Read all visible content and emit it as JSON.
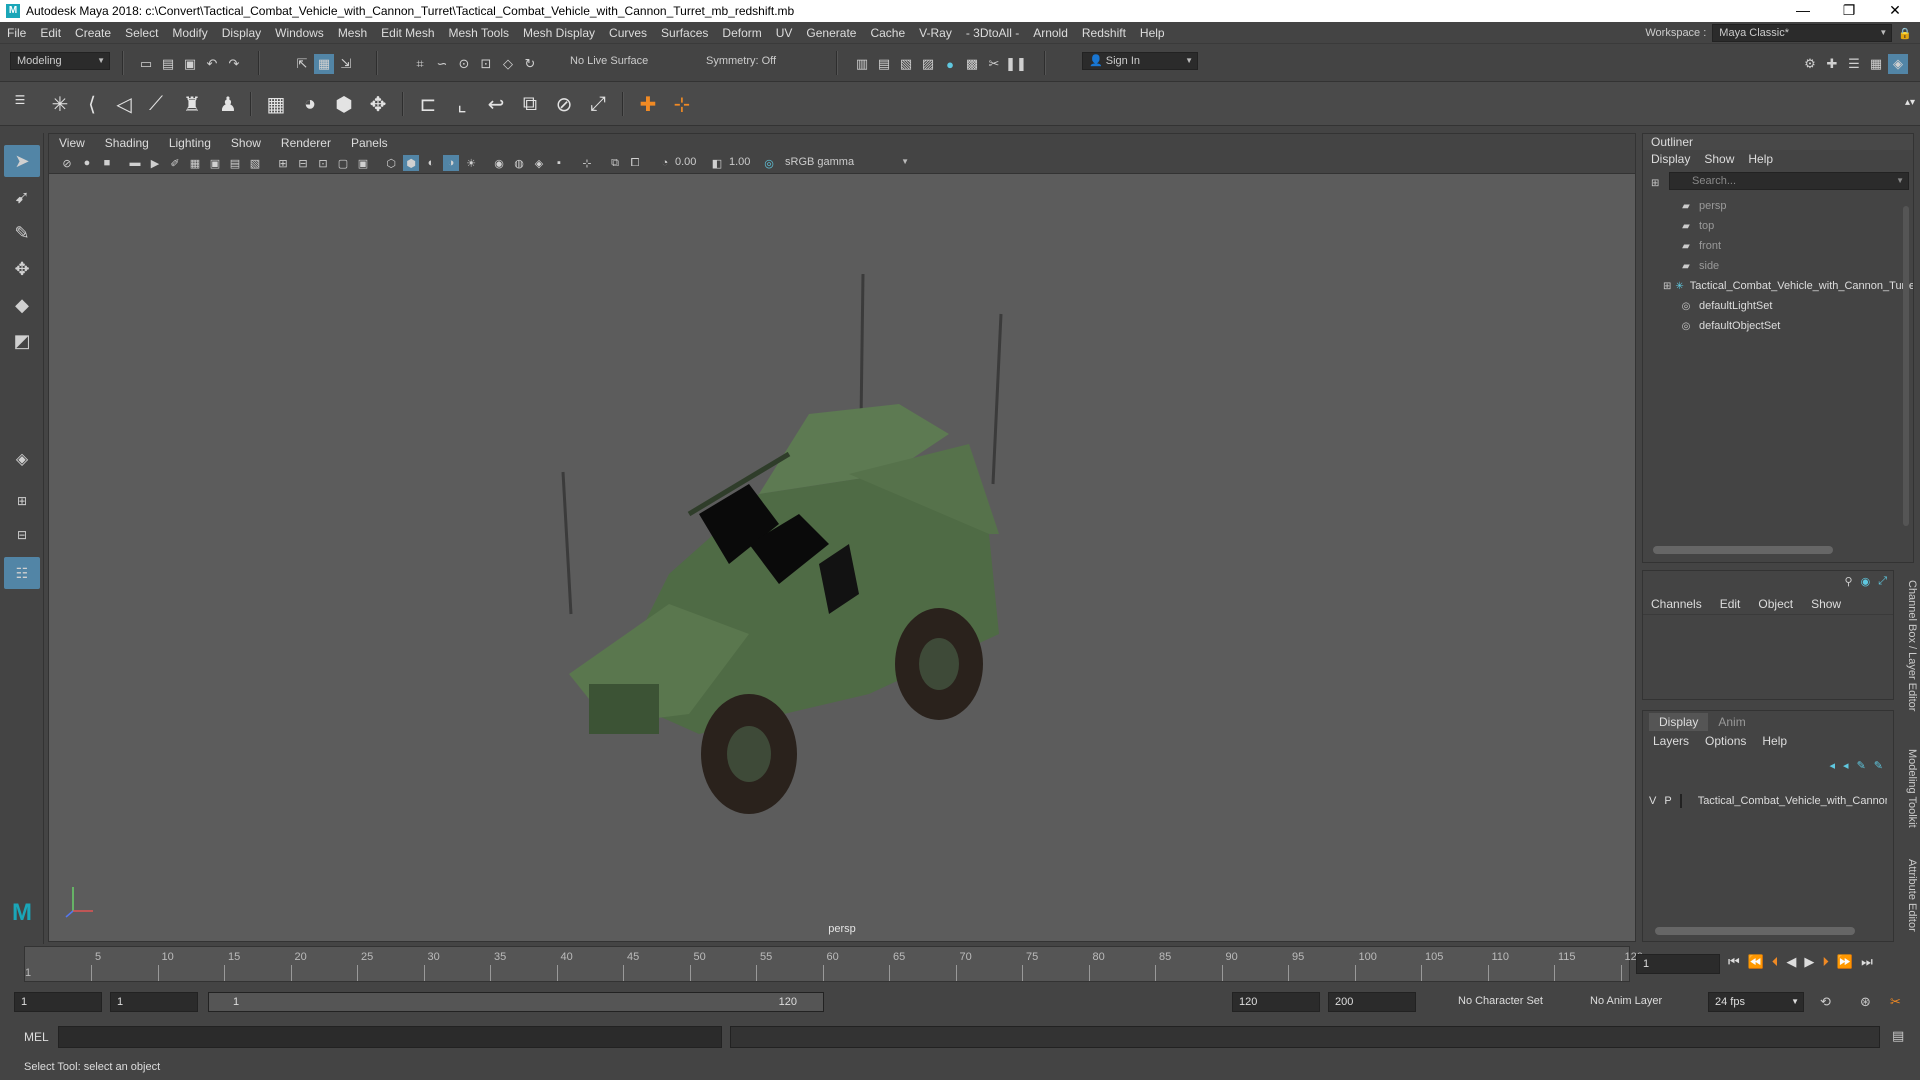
{
  "window": {
    "title": "Autodesk Maya 2018: c:\\Convert\\Tactical_Combat_Vehicle_with_Cannon_Turret\\Tactical_Combat_Vehicle_with_Cannon_Turret_mb_redshift.mb",
    "minimize": "—",
    "maximize": "❐",
    "close": "✕"
  },
  "menubar": [
    "File",
    "Edit",
    "Create",
    "Select",
    "Modify",
    "Display",
    "Windows",
    "Mesh",
    "Edit Mesh",
    "Mesh Tools",
    "Mesh Display",
    "Curves",
    "Surfaces",
    "Deform",
    "UV",
    "Generate",
    "Cache",
    "V-Ray",
    "- 3DtoAll -",
    "Arnold",
    "Redshift",
    "Help"
  ],
  "workspace": {
    "label": "Workspace :",
    "value": "Maya Classic*"
  },
  "statusline": {
    "mode": "Modeling",
    "live_surface": "No Live Surface",
    "symmetry": "Symmetry: Off",
    "sign_in": "Sign In"
  },
  "viewport": {
    "menus": [
      "View",
      "Shading",
      "Lighting",
      "Show",
      "Renderer",
      "Panels"
    ],
    "exposure": "0.00",
    "gamma": "1.00",
    "color_space": "sRGB gamma",
    "camera_label": "persp"
  },
  "outliner": {
    "title": "Outliner",
    "menus": [
      "Display",
      "Show",
      "Help"
    ],
    "search_placeholder": "Search...",
    "items": [
      {
        "label": "persp",
        "icon": "camera-icon"
      },
      {
        "label": "top",
        "icon": "camera-icon"
      },
      {
        "label": "front",
        "icon": "camera-icon"
      },
      {
        "label": "side",
        "icon": "camera-icon"
      },
      {
        "label": "Tactical_Combat_Vehicle_with_Cannon_Turret",
        "icon": "group-icon"
      },
      {
        "label": "defaultLightSet",
        "icon": "set-icon"
      },
      {
        "label": "defaultObjectSet",
        "icon": "set-icon"
      }
    ]
  },
  "channelbox": {
    "menus": [
      "Channels",
      "Edit",
      "Object",
      "Show"
    ]
  },
  "layereditor": {
    "tabs": [
      "Display",
      "Anim"
    ],
    "menus": [
      "Layers",
      "Options",
      "Help"
    ],
    "layer": {
      "v": "V",
      "p": "P",
      "name": "Tactical_Combat_Vehicle_with_Cannon_Turret"
    }
  },
  "sidetabs": [
    "Channel Box / Layer Editor",
    "Modeling Toolkit",
    "Attribute Editor"
  ],
  "timeline": {
    "ticks": [
      "5",
      "10",
      "15",
      "20",
      "25",
      "30",
      "35",
      "40",
      "45",
      "50",
      "55",
      "60",
      "65",
      "70",
      "75",
      "80",
      "85",
      "90",
      "95",
      "100",
      "105",
      "110",
      "115",
      "120"
    ],
    "first": "1",
    "current_frame": "1"
  },
  "range": {
    "start": "1",
    "playback_start": "1",
    "slider_start": "1",
    "slider_end": "120",
    "playback_end": "120",
    "end": "200",
    "character_set": "No Character Set",
    "anim_layer": "No Anim Layer",
    "fps": "24 fps"
  },
  "cmdline": {
    "label": "MEL"
  },
  "helpline": {
    "text": "Select Tool: select an object"
  },
  "colors": {
    "accent": "#5285a6",
    "viewport_bg": "#5c5c5c",
    "vehicle": "#4f6b45"
  }
}
